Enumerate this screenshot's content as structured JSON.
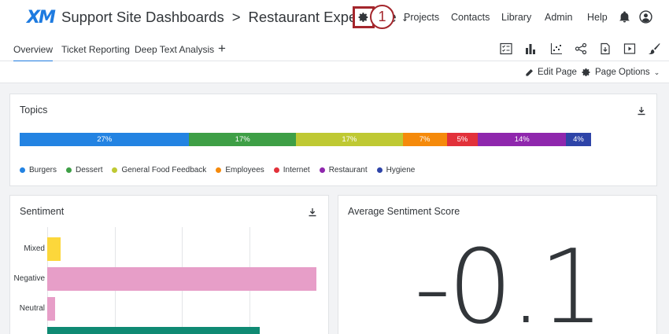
{
  "header": {
    "logo": "XM",
    "project": "Support Site Dashboards",
    "separator": ">",
    "dashboard": "Restaurant Experience",
    "step_number": "1",
    "nav": [
      "Projects",
      "Contacts",
      "Library",
      "Admin",
      "Help"
    ]
  },
  "tabs": [
    {
      "label": "Overview",
      "active": true
    },
    {
      "label": "Ticket Reporting",
      "active": false
    },
    {
      "label": "Deep Text Analysis",
      "active": false
    }
  ],
  "tab_add": "+",
  "actions": {
    "edit_page": "Edit Page",
    "page_options": "Page Options"
  },
  "topics": {
    "title": "Topics",
    "segments": [
      {
        "name": "Burgers",
        "value": 27,
        "label": "27%",
        "color": "#2383e2"
      },
      {
        "name": "Dessert",
        "value": 17,
        "label": "17%",
        "color": "#3e9f46"
      },
      {
        "name": "General Food Feedback",
        "value": 17,
        "label": "17%",
        "color": "#bfc933"
      },
      {
        "name": "Employees",
        "value": 7,
        "label": "7%",
        "color": "#f58a0b"
      },
      {
        "name": "Internet",
        "value": 5,
        "label": "5%",
        "color": "#e2313a"
      },
      {
        "name": "Restaurant",
        "value": 14,
        "label": "14%",
        "color": "#8f27ad"
      },
      {
        "name": "Hygiene",
        "value": 4,
        "label": "4%",
        "color": "#2e44a8"
      }
    ]
  },
  "sentiment": {
    "title": "Sentiment",
    "bars": [
      {
        "label": "Mixed",
        "value": 5,
        "color": "#fcd73b"
      },
      {
        "label": "Negative",
        "value": 100,
        "color": "#e79ec8"
      },
      {
        "label": "Neutral",
        "value": 3,
        "color": "#e79ec8"
      },
      {
        "label": "",
        "value": 79,
        "color": "#0f8a73"
      }
    ]
  },
  "average_sentiment": {
    "title": "Average Sentiment Score",
    "value": "-0.1"
  }
}
